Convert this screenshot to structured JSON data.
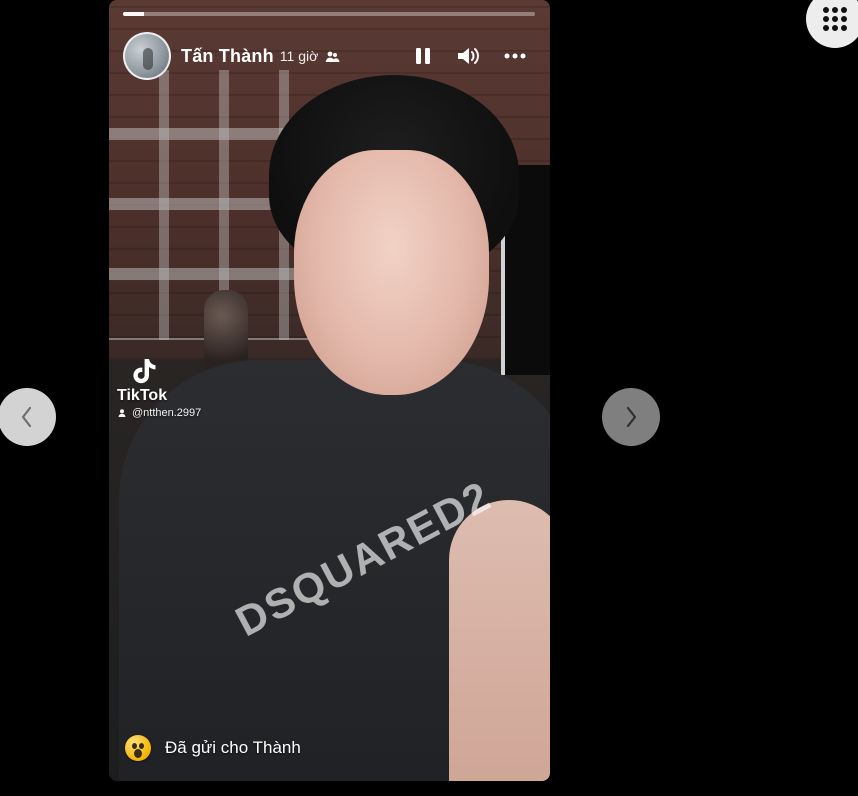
{
  "story": {
    "author_name": "Tấn Thành",
    "time_ago": "11 giờ",
    "progress_percent": 5,
    "watermark": {
      "brand": "TikTok",
      "handle": "@ntthen.2997"
    },
    "sent_status": "Đã gửi cho Thành",
    "shirt_print": "DSQUARED2"
  },
  "icons": {
    "audience": "friends-icon",
    "pause": "pause-icon",
    "volume": "volume-icon",
    "more": "more-options-icon",
    "prev": "chevron-left-icon",
    "next": "chevron-right-icon",
    "menu": "grid-menu-icon",
    "reaction": "wow-emoji-icon"
  },
  "colors": {
    "background": "#000000",
    "text_light": "#ffffff",
    "nav_prev_bg": "#d3d3d3",
    "nav_next_bg": "#7f7f7f",
    "menu_bg": "#ededed"
  }
}
